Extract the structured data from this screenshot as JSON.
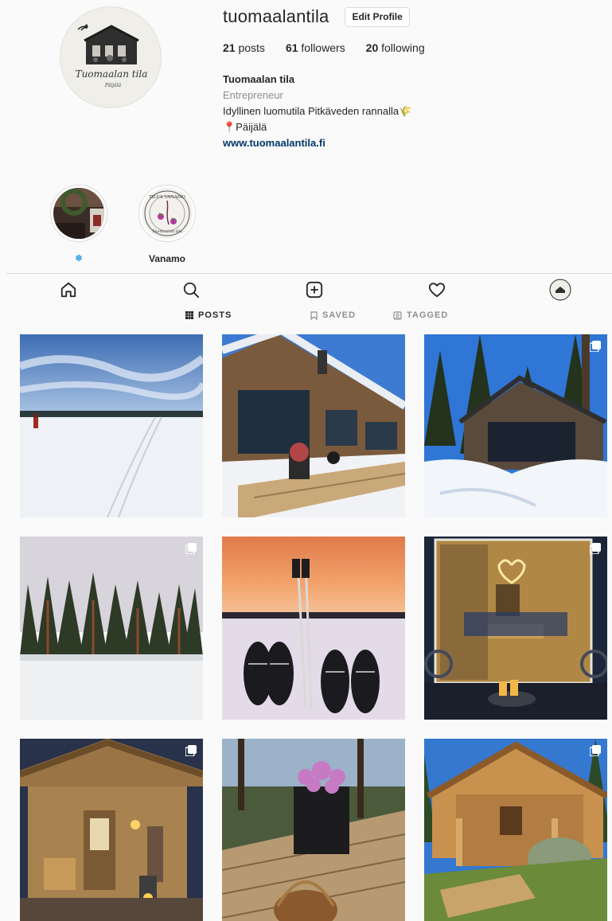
{
  "profile": {
    "username": "tuomaalantila",
    "edit_label": "Edit Profile",
    "logo_name": "Tuomaalan tila",
    "logo_sub": "Päijälä",
    "posts_count": "21",
    "posts_label": "posts",
    "followers_count": "61",
    "followers_label": "followers",
    "following_count": "20",
    "following_label": "following",
    "display_name": "Tuomaalan tila",
    "category": "Entrepreneur",
    "bio_line": "Idyllinen luomutila Pitkäveden rannalla🌾",
    "location": "📍Päijälä",
    "website": "www.tuomaalantila.fi"
  },
  "highlights": [
    {
      "label": "❄",
      "icon": "snowflake"
    },
    {
      "label": "Vanamo",
      "ring_text": "TILUA VANAMO",
      "ring_sub": "Tuomaalan tila"
    }
  ],
  "nav": [
    "home-icon",
    "search-icon",
    "new-post-icon",
    "heart-icon",
    "profile-avatar"
  ],
  "tabs": [
    {
      "label": "POSTS",
      "icon": "grid-icon",
      "active": true
    },
    {
      "label": "SAVED",
      "icon": "bookmark-icon",
      "active": false
    },
    {
      "label": "TAGGED",
      "icon": "tag-icon",
      "active": false
    }
  ],
  "posts": [
    {
      "subject": "frozen-lake-skier",
      "multiple": false
    },
    {
      "subject": "wooden-house-porch",
      "multiple": false
    },
    {
      "subject": "house-in-snow-forest",
      "multiple": true
    },
    {
      "subject": "forest-island-winter",
      "multiple": true
    },
    {
      "subject": "snowshoes-sunset",
      "multiple": false
    },
    {
      "subject": "window-dining-room",
      "multiple": true
    },
    {
      "subject": "sauna-porch-lanterns",
      "multiple": true
    },
    {
      "subject": "flower-pot-deck",
      "multiple": false
    },
    {
      "subject": "log-cabin",
      "multiple": true
    }
  ],
  "colors": {
    "link": "#00376b",
    "muted": "#8e8e8e",
    "border": "#dbdbdb"
  }
}
